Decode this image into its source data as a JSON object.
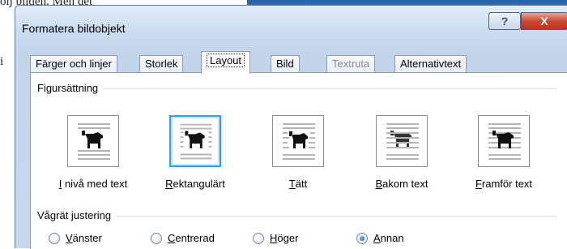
{
  "background": {
    "doc_text": "ölj bilden. Men det",
    "margin_glyph": "i"
  },
  "window": {
    "title": "Formatera bildobjekt",
    "help_glyph": "?",
    "close_glyph": "X"
  },
  "tabs": [
    {
      "label": "Färger och linjer",
      "state": "normal"
    },
    {
      "label": "Storlek",
      "state": "normal"
    },
    {
      "label": "Layout",
      "state": "active"
    },
    {
      "label": "Bild",
      "state": "normal"
    },
    {
      "label": "Textruta",
      "state": "disabled"
    },
    {
      "label": "Alternativtext",
      "state": "normal"
    }
  ],
  "wrapping": {
    "section_label": "Figursättning",
    "options": [
      {
        "accel": "I",
        "rest": " nivå med text",
        "icon": "in-line-with-text-icon",
        "selected": false
      },
      {
        "accel": "R",
        "rest": "ektangulärt",
        "icon": "square-wrap-icon",
        "selected": true
      },
      {
        "accel": "T",
        "rest": "ätt",
        "icon": "tight-wrap-icon",
        "selected": false
      },
      {
        "accel": "B",
        "rest": "akom text",
        "icon": "behind-text-icon",
        "selected": false
      },
      {
        "accel": "F",
        "rest": "ramför text",
        "icon": "in-front-of-text-icon",
        "selected": false
      }
    ]
  },
  "alignment": {
    "section_label": "Vågrät justering",
    "options": [
      {
        "accel": "V",
        "rest": "änster",
        "checked": false
      },
      {
        "accel": "C",
        "rest": "entrerad",
        "checked": false
      },
      {
        "accel": "H",
        "rest": "öger",
        "checked": false
      },
      {
        "accel": "A",
        "rest": "nnan",
        "checked": true
      }
    ]
  },
  "colors": {
    "selection_border": "#3399ff",
    "close_button": "#c94b33",
    "window_frame": "#c9dbef"
  }
}
